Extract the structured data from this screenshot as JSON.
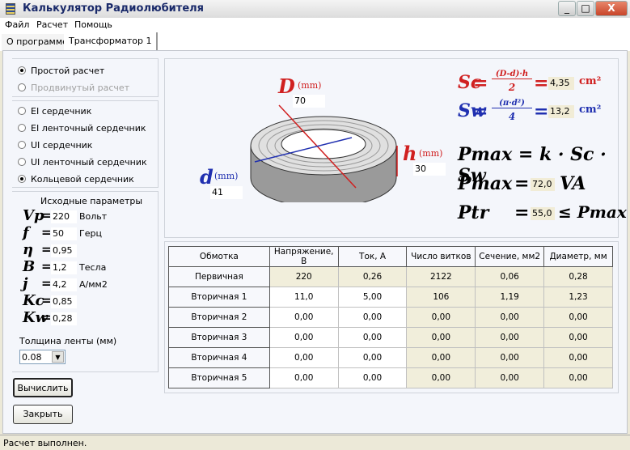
{
  "window": {
    "title": "Калькулятор Радиолюбителя",
    "minimize": "_",
    "maximize": "□",
    "close": "X"
  },
  "menu": [
    "Файл",
    "Расчет",
    "Помощь"
  ],
  "tabs": [
    "О программе",
    "Трансформатор 1"
  ],
  "mode": {
    "options": [
      {
        "label": "Простой расчет",
        "checked": true,
        "enabled": true
      },
      {
        "label": "Продвинутый расчет",
        "checked": false,
        "enabled": false
      }
    ]
  },
  "core": {
    "options": [
      {
        "label": "EI сердечник",
        "checked": false
      },
      {
        "label": "EI ленточный сердечник",
        "checked": false
      },
      {
        "label": "UI сердечник",
        "checked": false
      },
      {
        "label": "UI ленточный сердечник",
        "checked": false
      },
      {
        "label": "Кольцевой сердечник",
        "checked": true
      }
    ]
  },
  "params": {
    "title": "Исходные параметры",
    "eq": "=",
    "rows": [
      {
        "sym": "Vp",
        "value": "220",
        "unit": "Вольт"
      },
      {
        "sym": "f",
        "value": "50",
        "unit": "Герц"
      },
      {
        "sym": "η",
        "value": "0,95",
        "unit": ""
      },
      {
        "sym": "B",
        "value": "1,2",
        "unit": "Тесла"
      },
      {
        "sym": "j",
        "value": "4,2",
        "unit": "А/мм2"
      },
      {
        "sym": "Kc",
        "value": "0,85",
        "unit": ""
      },
      {
        "sym": "Kw",
        "value": "0,28",
        "unit": ""
      }
    ],
    "tape_label": "Толщина ленты (мм)",
    "tape_value": "0.08"
  },
  "buttons": {
    "calc": "Вычислить",
    "close": "Закрыть"
  },
  "diagram": {
    "D": "D",
    "d": "d",
    "h": "h",
    "mm": "(mm)",
    "D_value": "70",
    "d_value": "41",
    "h_value": "30"
  },
  "formulas": {
    "sc_lhs": "Sc",
    "sc_num": "(D-d)·h",
    "sc_den": "2",
    "sc_value": "4,35",
    "sw_lhs": "Sw",
    "sw_num": "(π·d²)",
    "sw_den": "4",
    "sw_value": "13,2",
    "unit": "cm²",
    "eq": "=",
    "pmax_formula": "Pmax = k · Sc · Sw",
    "pmax_lhs": "Pmax",
    "pmax_value": "72,0",
    "va": "VA",
    "ptr_lhs": "Ptr",
    "ptr_value": "55,0",
    "ptr_rhs": "≤ Pmax",
    "red": "#d02020",
    "blue": "#2030b0"
  },
  "table": {
    "headers": [
      "Обмотка",
      "Напряжение, В",
      "Ток, А",
      "Число витков",
      "Сечение, мм2",
      "Диаметр, мм"
    ],
    "rows": [
      [
        "Первичная",
        "220",
        "0,26",
        "2122",
        "0,06",
        "0,28"
      ],
      [
        "Вторичная 1",
        "11,0",
        "5,00",
        "106",
        "1,19",
        "1,23"
      ],
      [
        "Вторичная 2",
        "0,00",
        "0,00",
        "0,00",
        "0,00",
        "0,00"
      ],
      [
        "Вторичная 3",
        "0,00",
        "0,00",
        "0,00",
        "0,00",
        "0,00"
      ],
      [
        "Вторичная 4",
        "0,00",
        "0,00",
        "0,00",
        "0,00",
        "0,00"
      ],
      [
        "Вторичная 5",
        "0,00",
        "0,00",
        "0,00",
        "0,00",
        "0,00"
      ]
    ]
  },
  "status": "Расчет выполнен."
}
